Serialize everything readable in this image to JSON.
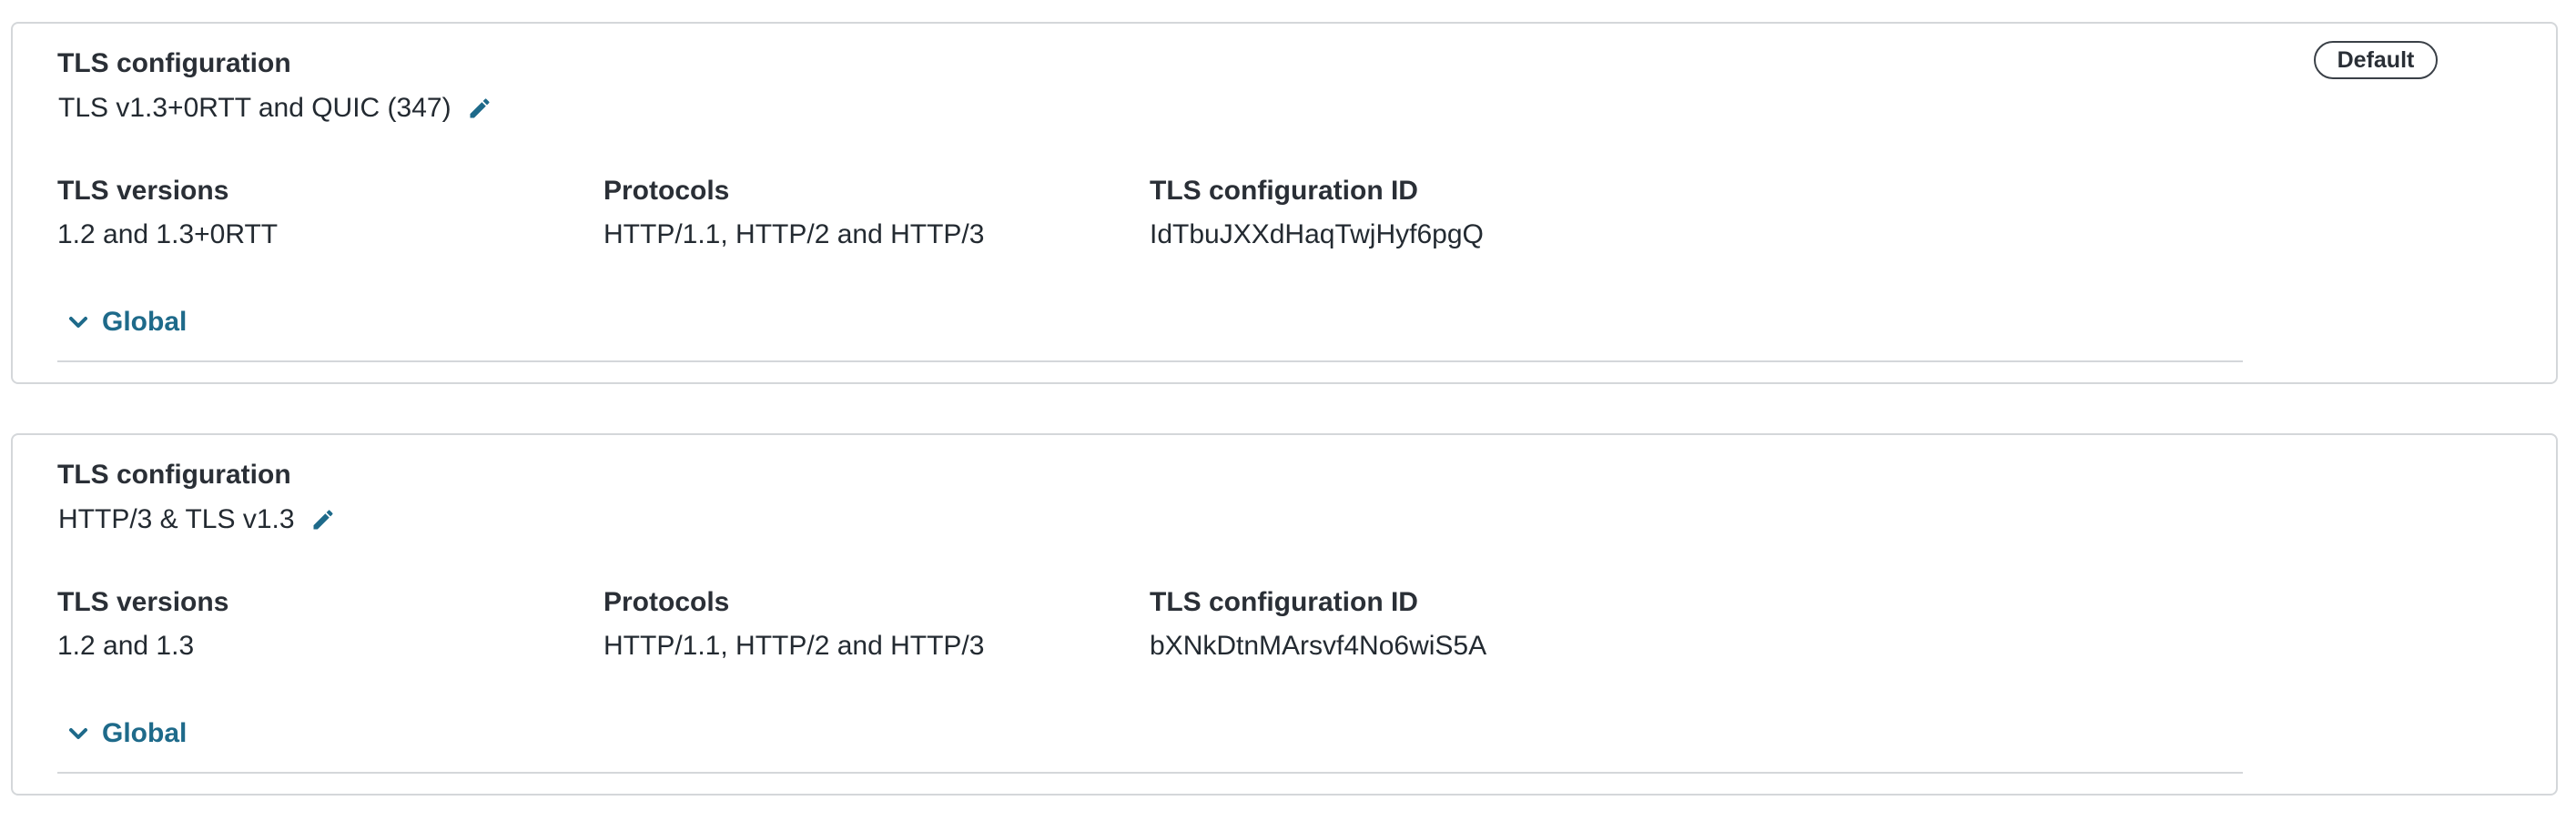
{
  "cards": [
    {
      "section_label": "TLS configuration",
      "name": "TLS v1.3+0RTT and QUIC (347)",
      "badge": "Default",
      "fields": [
        {
          "label": "TLS versions",
          "value": "1.2 and 1.3+0RTT"
        },
        {
          "label": "Protocols",
          "value": "HTTP/1.1, HTTP/2 and HTTP/3"
        },
        {
          "label": "TLS configuration ID",
          "value": "IdTbuJXXdHaqTwjHyf6pgQ"
        }
      ],
      "expander_label": "Global"
    },
    {
      "section_label": "TLS configuration",
      "name": "HTTP/3 & TLS v1.3",
      "fields": [
        {
          "label": "TLS versions",
          "value": "1.2 and 1.3"
        },
        {
          "label": "Protocols",
          "value": "HTTP/1.1, HTTP/2 and HTTP/3"
        },
        {
          "label": "TLS configuration ID",
          "value": "bXNkDtnMArsvf4No6wiS5A"
        }
      ],
      "expander_label": "Global"
    }
  ],
  "colors": {
    "accent": "#1e6a8a",
    "border": "#d4d7da",
    "text": "#232a31"
  },
  "icons": {
    "edit": "pencil-icon",
    "expand": "chevron-down-icon"
  }
}
